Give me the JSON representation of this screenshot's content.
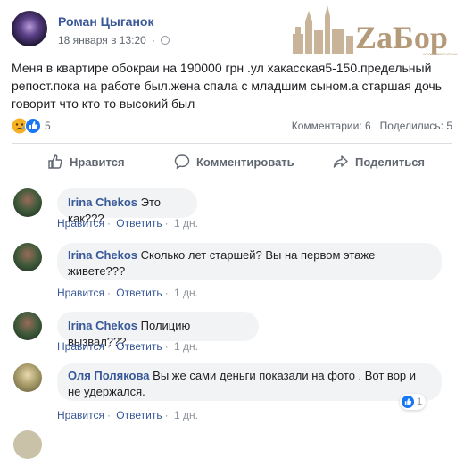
{
  "post": {
    "author": "Роман Цыганок",
    "date": "18 января в 13:20",
    "privacy_icon": "globe-icon",
    "text": "Меня в квартире обокраи на 190000 грн .ул хакасская5-150.предельный репост.пока на работе был.жена спала с младшим сыном.а старшая дочь говорит что кто то высокий был"
  },
  "watermark": {
    "text": "ZaБор",
    "color": "#b59a7a"
  },
  "stats": {
    "reaction_count": "5",
    "comments": "Комментарии: 6",
    "shares": "Поделились: 5"
  },
  "actions": {
    "like": "Нравится",
    "comment": "Комментировать",
    "share": "Поделиться"
  },
  "comment_actions": {
    "like": "Нравится",
    "reply": "Ответить"
  },
  "comments": [
    {
      "name": "Irina Chekos",
      "text": "Это как???",
      "time": "1 дн."
    },
    {
      "name": "Irina Chekos",
      "text": "Сколько лет старшей? Вы на первом этаже живете???",
      "time": "1 дн."
    },
    {
      "name": "Irina Chekos",
      "text": "Полицию вызвал???",
      "time": "1 дн."
    },
    {
      "name": "Оля Полякова",
      "text": "Вы же сами деньги показали на фото . Вот вор и не удержался.",
      "time": "1 дн.",
      "likes": "1"
    }
  ],
  "colors": {
    "link": "#385898",
    "like_blue": "#1877f2",
    "bubble": "#f2f3f5"
  }
}
